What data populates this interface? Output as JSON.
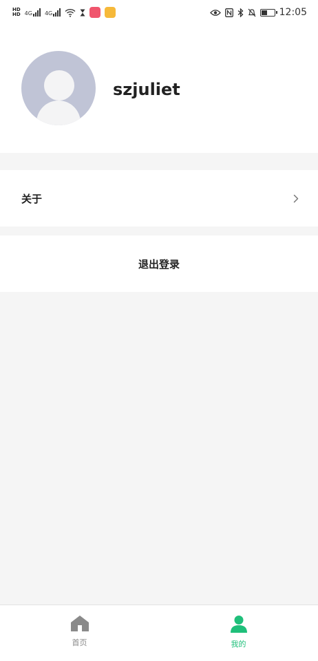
{
  "status_bar": {
    "left_badge_top": "HD",
    "left_badge_bottom": "HD",
    "net1": "4G",
    "net2": "4G",
    "time": "12:05",
    "battery_level": 0.45
  },
  "profile": {
    "username": "szjuliet"
  },
  "menu": {
    "about_label": "关于",
    "logout_label": "退出登录"
  },
  "tabs": [
    {
      "label": "首页",
      "icon": "home-icon",
      "active": false
    },
    {
      "label": "我的",
      "icon": "user-icon",
      "active": true
    }
  ],
  "colors": {
    "accent": "#1fbf7a",
    "inactive": "#888888",
    "avatar_bg": "#c0c4d6",
    "page_bg": "#f5f5f5"
  }
}
